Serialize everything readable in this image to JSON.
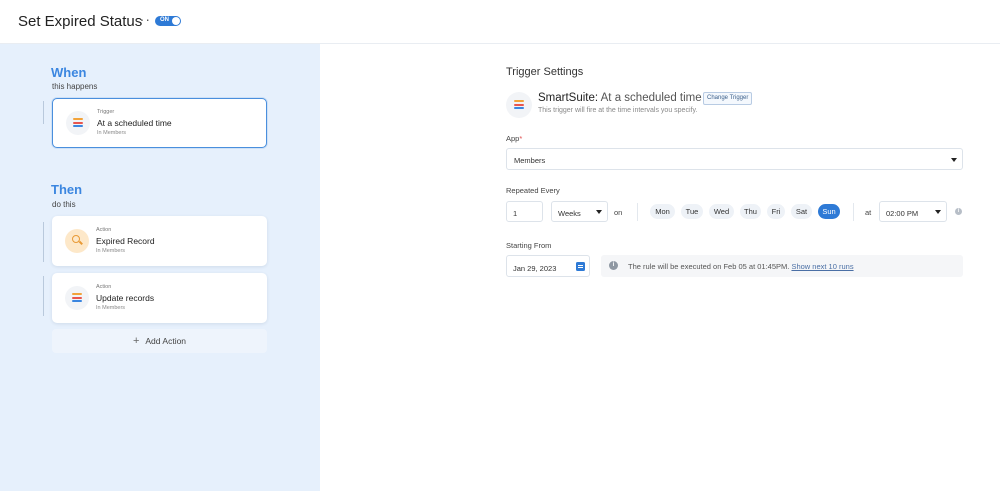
{
  "header": {
    "title": "Set Expired Status",
    "more": "···",
    "toggle_label": "ON"
  },
  "left": {
    "when_title": "When",
    "when_sub": "this happens",
    "then_title": "Then",
    "then_sub": "do this",
    "trigger_card": {
      "kind": "Trigger",
      "name": "At a scheduled time",
      "app": "In Members"
    },
    "action_cards": [
      {
        "kind": "Action",
        "name": "Expired Record",
        "app": "In Members"
      },
      {
        "kind": "Action",
        "name": "Update records",
        "app": "In Members"
      }
    ],
    "add_action": "Add Action",
    "add_plus": "+"
  },
  "settings": {
    "title": "Trigger Settings",
    "trigger_app": "SmartSuite:",
    "trigger_name": "At a scheduled time",
    "change_trigger": "Change Trigger",
    "trigger_desc": "This trigger will fire at the time intervals you specify.",
    "app_label": "App",
    "app_required": "*",
    "app_value": "Members",
    "repeat_label": "Repeated Every",
    "repeat_number": "1",
    "repeat_unit": "Weeks",
    "on_text": "on",
    "days": [
      "Mon",
      "Tue",
      "Wed",
      "Thu",
      "Fri",
      "Sat",
      "Sun"
    ],
    "active_day": "Sun",
    "at_text": "at",
    "time_value": "02:00 PM",
    "start_label": "Starting From",
    "start_date": "Jan 29, 2023",
    "note_text": "The rule will be executed on Feb 05 at 01:45PM.",
    "note_link": "Show next 10 runs",
    "info_glyph": "i"
  },
  "colors": {
    "accent": "#2e7ad6",
    "left_panel": "#e6f0fc",
    "section_title": "#3b86e0"
  },
  "icons": {
    "trigger": "smartsuite-logo-icon",
    "action_1": "search-icon",
    "action_2": "smartsuite-logo-icon",
    "calendar": "calendar-icon"
  }
}
